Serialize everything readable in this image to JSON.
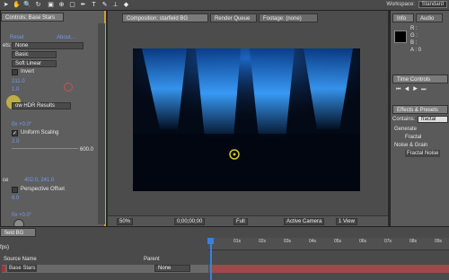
{
  "toolbar": {
    "workspace_label": "Workspace:",
    "workspace_value": "Standard"
  },
  "left_panel": {
    "tab_label": "Controls: Base Stars",
    "reset": "Reset",
    "about": "About...",
    "row_none_label": "ets:",
    "row_none_value": "None",
    "dd_basic": "Basic",
    "dd_soft_linear": "Soft Linear",
    "invert": "Invert",
    "val_211": "211.0",
    "val_10": "1.0",
    "dd_hdr": "ow HDR Results",
    "val_0x": "0x +0.0°",
    "uniform_scaling": "Uniform Scaling",
    "val_2": "2.0",
    "val_600": "600.0",
    "val_402": "402.0, 241.0",
    "ce": "ce",
    "perspective_offset": "Perspective Offset",
    "val_6": "6.0",
    "val_0x_b": "0x +0.0°"
  },
  "comp": {
    "tabs": [
      "Composition: starfield BG",
      "Render Queue",
      "Footage: (none)"
    ],
    "footer": [
      "50%",
      "0;00;00;00",
      "Full",
      "Active Camera",
      "1 View"
    ]
  },
  "right_col": {
    "tabs": [
      "Info",
      "Audio"
    ],
    "info_lines": [
      "R :",
      "G :",
      "B :",
      "A : 0"
    ],
    "time_controls": "Time Controls",
    "effects_tab": "Effects & Presets",
    "contains_label": "Contains:",
    "contains_value": "fractal",
    "generate": "Generate",
    "fractal": "Fractal",
    "noise_grain": "Noise & Grain",
    "fractal_noise": "Fractal Noise"
  },
  "timeline": {
    "tab_label": "field BG",
    "fps": "fps)",
    "source_name": "Source Name",
    "parent": "Parent",
    "layer_name": "Base Stars",
    "parent_value": "None",
    "ticks": [
      "01s",
      "02s",
      "03s",
      "04s",
      "05s",
      "06s",
      "07s",
      "08s",
      "09s",
      "10s"
    ]
  },
  "colors": {
    "highlight": "#c9a42c",
    "playhead": "#3c7fe0",
    "layer": "#9c4a4a"
  }
}
